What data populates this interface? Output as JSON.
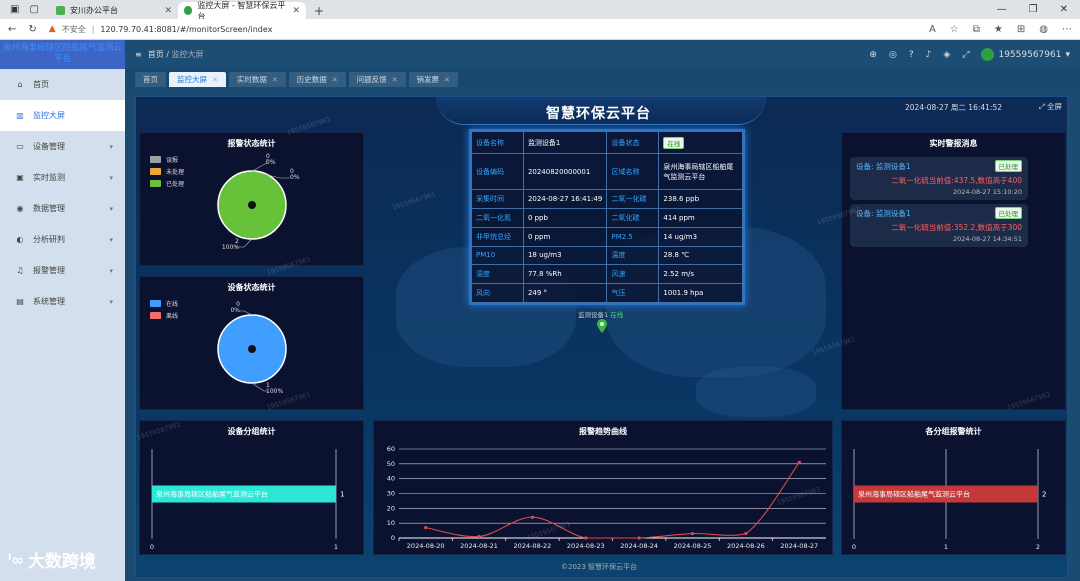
{
  "browser": {
    "tabs": [
      {
        "title": "安川办公平台",
        "active": false
      },
      {
        "title": "监控大屏 - 智慧环保云平台",
        "active": true
      }
    ],
    "address": {
      "security": "不安全",
      "url": "120.79.70.41:8081/#/monitorScreen/index"
    }
  },
  "sidebar": {
    "brand": "泉州海事局辖区船舶尾气监测云平台",
    "items": [
      {
        "label": "首页",
        "icon": "home-icon",
        "active": false,
        "expandable": false
      },
      {
        "label": "监控大屏",
        "icon": "chart-icon",
        "active": true,
        "expandable": false
      },
      {
        "label": "设备管理",
        "icon": "device-icon",
        "active": false,
        "expandable": true
      },
      {
        "label": "实时监测",
        "icon": "monitor-icon",
        "active": false,
        "expandable": true
      },
      {
        "label": "数据管理",
        "icon": "database-icon",
        "active": false,
        "expandable": true
      },
      {
        "label": "分析研判",
        "icon": "analysis-icon",
        "active": false,
        "expandable": true
      },
      {
        "label": "报警管理",
        "icon": "bell-icon",
        "active": false,
        "expandable": true
      },
      {
        "label": "系统管理",
        "icon": "system-icon",
        "active": false,
        "expandable": true
      }
    ]
  },
  "header": {
    "breadcrumb": [
      "首页",
      "监控大屏"
    ],
    "user": "19559567961"
  },
  "app_tabs": [
    {
      "label": "首页",
      "active": false,
      "closable": false
    },
    {
      "label": "监控大屏",
      "active": true,
      "closable": true
    },
    {
      "label": "实时数据",
      "active": false,
      "closable": true
    },
    {
      "label": "历史数据",
      "active": false,
      "closable": true
    },
    {
      "label": "问题反馈",
      "active": false,
      "closable": true
    },
    {
      "label": "销发票",
      "active": false,
      "closable": true
    }
  ],
  "dashboard": {
    "title": "智慧环保云平台",
    "datetime": "2024-08-27 周二 16:41:52",
    "fullscreen_label": "全屏",
    "footer": "©2023 智慧环保云平台",
    "watermark": "19559567961",
    "alarm_status": {
      "title": "报警状态统计",
      "legend": [
        "误报",
        "未处理",
        "已处理"
      ],
      "colors": [
        "#9aa0a6",
        "#f0a73a",
        "#67c23a"
      ],
      "labels": [
        "0\n0%",
        "0\n0%",
        "2\n100%"
      ]
    },
    "device_status": {
      "title": "设备状态统计",
      "legend": [
        "在线",
        "离线"
      ],
      "colors": [
        "#409eff",
        "#f56c6c"
      ],
      "labels": [
        "0\n0%",
        "1\n100%"
      ]
    },
    "device_info": {
      "rows": [
        [
          {
            "k": "设备名称",
            "v": "监测设备1"
          },
          {
            "k": "设备状态",
            "v": "在线",
            "badge": true
          }
        ],
        [
          {
            "k": "设备编码",
            "v": "20240820000001"
          },
          {
            "k": "区域名称",
            "v": "泉州海事局辖区船舶尾气监测云平台"
          }
        ],
        [
          {
            "k": "采集时间",
            "v": "2024-08-27 16:41:49"
          },
          {
            "k": "二氧一化碳",
            "v": "238.6 ppb"
          }
        ],
        [
          {
            "k": "二氧一化氮",
            "v": "0 ppb"
          },
          {
            "k": "二氧化碳",
            "v": "414 ppm"
          }
        ],
        [
          {
            "k": "非甲烷总烃",
            "v": "0 ppm"
          },
          {
            "k": "PM2.5",
            "v": "14 ug/m3"
          }
        ],
        [
          {
            "k": "PM10",
            "v": "18 ug/m3"
          },
          {
            "k": "温度",
            "v": "28.8 ℃"
          }
        ],
        [
          {
            "k": "湿度",
            "v": "77.8 %Rh"
          },
          {
            "k": "风速",
            "v": "2.52 m/s"
          }
        ],
        [
          {
            "k": "风向",
            "v": "249 °"
          },
          {
            "k": "气压",
            "v": "1001.9 hpa"
          }
        ]
      ]
    },
    "map_marker": {
      "name": "监测设备1",
      "status": "在线"
    },
    "realtime_alarms": {
      "title": "实时警报消息",
      "items": [
        {
          "device": "设备: 监测设备1",
          "status": "已处理",
          "message": "二氧一化硫当前值:437.5,数值高于400",
          "time": "2024-08-27 15:10:20"
        },
        {
          "device": "设备: 监测设备1",
          "status": "已处理",
          "message": "二氧一化硫当前值:352.2,数值高于300",
          "time": "2024-08-27 14:34:51"
        }
      ]
    },
    "device_group": {
      "title": "设备分组统计"
    },
    "alarm_trend": {
      "title": "报警趋势曲线"
    },
    "group_alarm": {
      "title": "各分组报警统计"
    }
  },
  "chart_data": [
    {
      "type": "pie",
      "categories": [
        "误报",
        "未处理",
        "已处理"
      ],
      "values": [
        0,
        0,
        2
      ]
    },
    {
      "type": "pie",
      "categories": [
        "在线",
        "离线"
      ],
      "values": [
        1,
        0
      ]
    },
    {
      "type": "bar",
      "orientation": "horizontal",
      "categories": [
        "泉州海事局辖区船舶尾气监测云平台"
      ],
      "values": [
        1
      ],
      "xlim": [
        0,
        1
      ],
      "xticks": [
        0,
        1
      ],
      "color": "#2ee6d6"
    },
    {
      "type": "line",
      "x": [
        "2024-08-20",
        "2024-08-21",
        "2024-08-22",
        "2024-08-23",
        "2024-08-24",
        "2024-08-25",
        "2024-08-26",
        "2024-08-27"
      ],
      "values": [
        7,
        1,
        14,
        0,
        0,
        3,
        3,
        51
      ],
      "ylim": [
        0,
        60
      ],
      "yticks": [
        0,
        10,
        20,
        30,
        40,
        50,
        60
      ],
      "color": "#e04a4a"
    },
    {
      "type": "bar",
      "orientation": "horizontal",
      "categories": [
        "泉州海事局辖区船舶尾气监测云平台"
      ],
      "values": [
        2
      ],
      "xlim": [
        0,
        2
      ],
      "xticks": [
        0,
        1,
        2
      ],
      "color": "#c43a3a"
    }
  ]
}
